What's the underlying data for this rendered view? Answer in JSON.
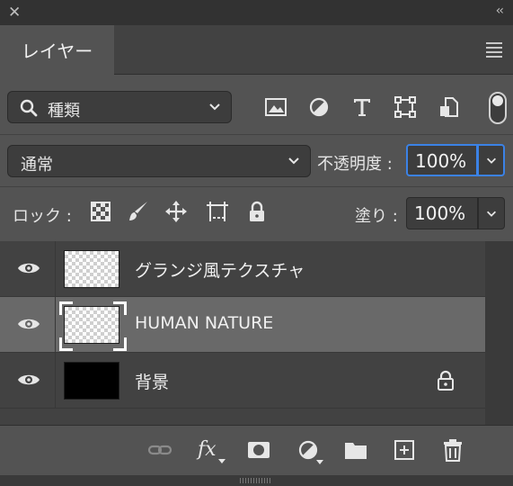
{
  "panel": {
    "tab_label": "レイヤー",
    "close_glyph": "✕",
    "collapse_glyph": "‹‹"
  },
  "filter": {
    "kind_label": "種類",
    "icons": [
      "image-filter-icon",
      "adjustment-filter-icon",
      "type-filter-icon",
      "shape-filter-icon",
      "smart-object-filter-icon"
    ],
    "toggle_on": true
  },
  "blend": {
    "mode": "通常",
    "opacity_label": "不透明度 :",
    "opacity_value": "100%"
  },
  "lock": {
    "label": "ロック :",
    "icons": [
      "lock-transparent-pixels-icon",
      "lock-image-pixels-icon",
      "lock-position-icon",
      "lock-artboard-icon",
      "lock-all-icon"
    ],
    "fill_label": "塗り :",
    "fill_value": "100%"
  },
  "layers": [
    {
      "name": "グランジ風テクスチャ",
      "thumb": "checker",
      "visible": true,
      "selected": false,
      "locked": false
    },
    {
      "name": "HUMAN NATURE",
      "thumb": "checker",
      "visible": true,
      "selected": true,
      "locked": false
    },
    {
      "name": "背景",
      "thumb": "black",
      "visible": true,
      "selected": false,
      "locked": true
    }
  ],
  "footer": {
    "icons": [
      "link-layers-icon",
      "fx-icon",
      "add-mask-icon",
      "new-adjustment-icon",
      "new-group-icon",
      "new-layer-icon",
      "delete-layer-icon"
    ],
    "fx_text": "fx"
  },
  "colors": {
    "panel_bg": "#535353",
    "list_bg": "#424242",
    "selected_row": "#696969",
    "focus_blue": "#3b82e6"
  }
}
